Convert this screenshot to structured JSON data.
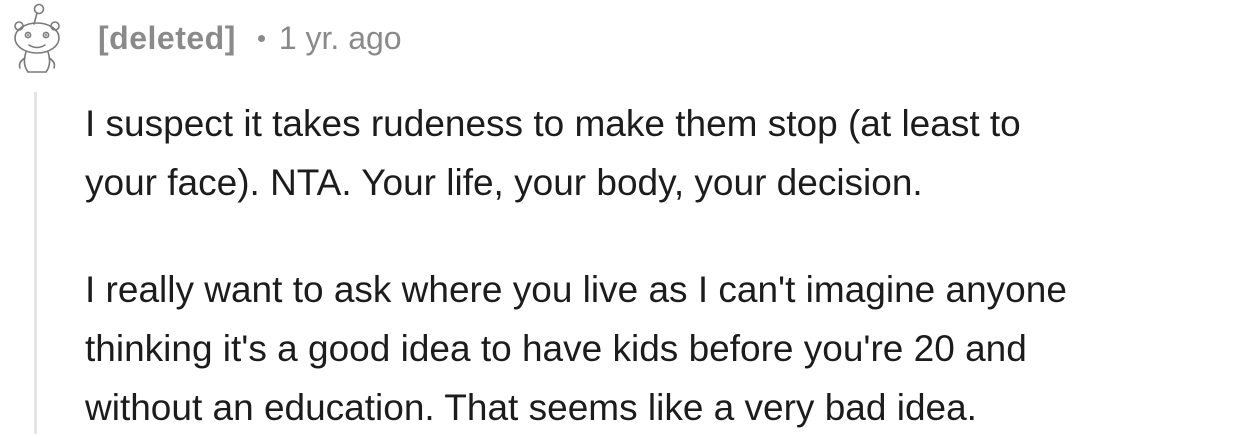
{
  "comment": {
    "author": "[deleted]",
    "timestamp": "1 yr. ago",
    "avatar_icon": "reddit-snoo-outline-icon",
    "paragraphs": [
      "I suspect it takes rudeness to make them stop (at least to\nyour face). NTA. Your life, your body, your decision.",
      "I really want to ask where you live as I can't imagine anyone\nthinking it's a good idea to have kids before you're 20 and\nwithout an education. That seems like a very bad idea."
    ]
  },
  "colors": {
    "meta_text": "#8a8a8a",
    "body_text": "#1c1c1c",
    "thread_line": "#e4e4e4",
    "background": "#ffffff"
  }
}
